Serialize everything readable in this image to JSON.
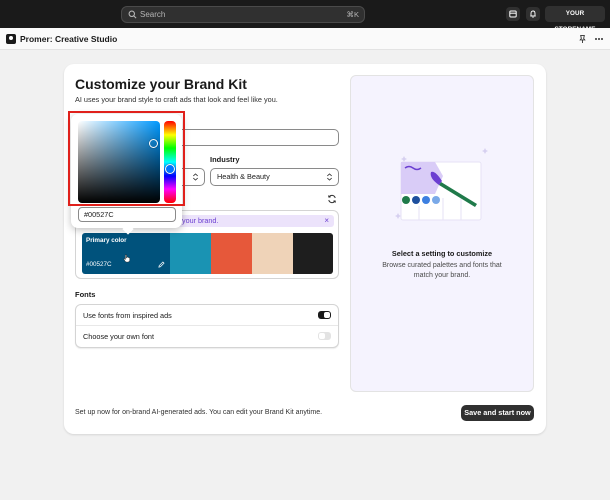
{
  "topbar": {
    "search_placeholder": "Search",
    "search_shortcut": "⌘K",
    "store_label": "YOUR STORENAME"
  },
  "app": {
    "title": "Promer: Creative Studio"
  },
  "main": {
    "title": "Customize your Brand Kit",
    "subtitle": "AI uses your brand style to craft ads that look and feel like you.",
    "industry_label": "Industry",
    "industry_value": "Health & Beauty",
    "banner_text": "your brand.",
    "banner_close": "×",
    "palette": {
      "primary_label": "Primary color",
      "primary_hex": "#00527C",
      "colors": [
        "#00527c",
        "#1a93b3",
        "#e6583a",
        "#efd3b8",
        "#1e1e1e"
      ]
    },
    "fonts_label": "Fonts",
    "font_options": [
      {
        "label": "Use fonts from inspired ads",
        "enabled": true
      },
      {
        "label": "Choose your own font",
        "enabled": false
      }
    ],
    "footer_text": "Set up now for on-brand AI-generated ads. You can edit your Brand Kit anytime.",
    "save_button": "Save and start now"
  },
  "panel": {
    "title": "Select a setting to customize",
    "description": "Browse curated palettes and fonts that match your brand."
  },
  "picker": {
    "hex_value": "#00527C",
    "hue_color": "#0073ff"
  },
  "colors": {
    "accent": "#303030",
    "highlight": "#e0201b",
    "banner_text": "#6b3fd1"
  }
}
